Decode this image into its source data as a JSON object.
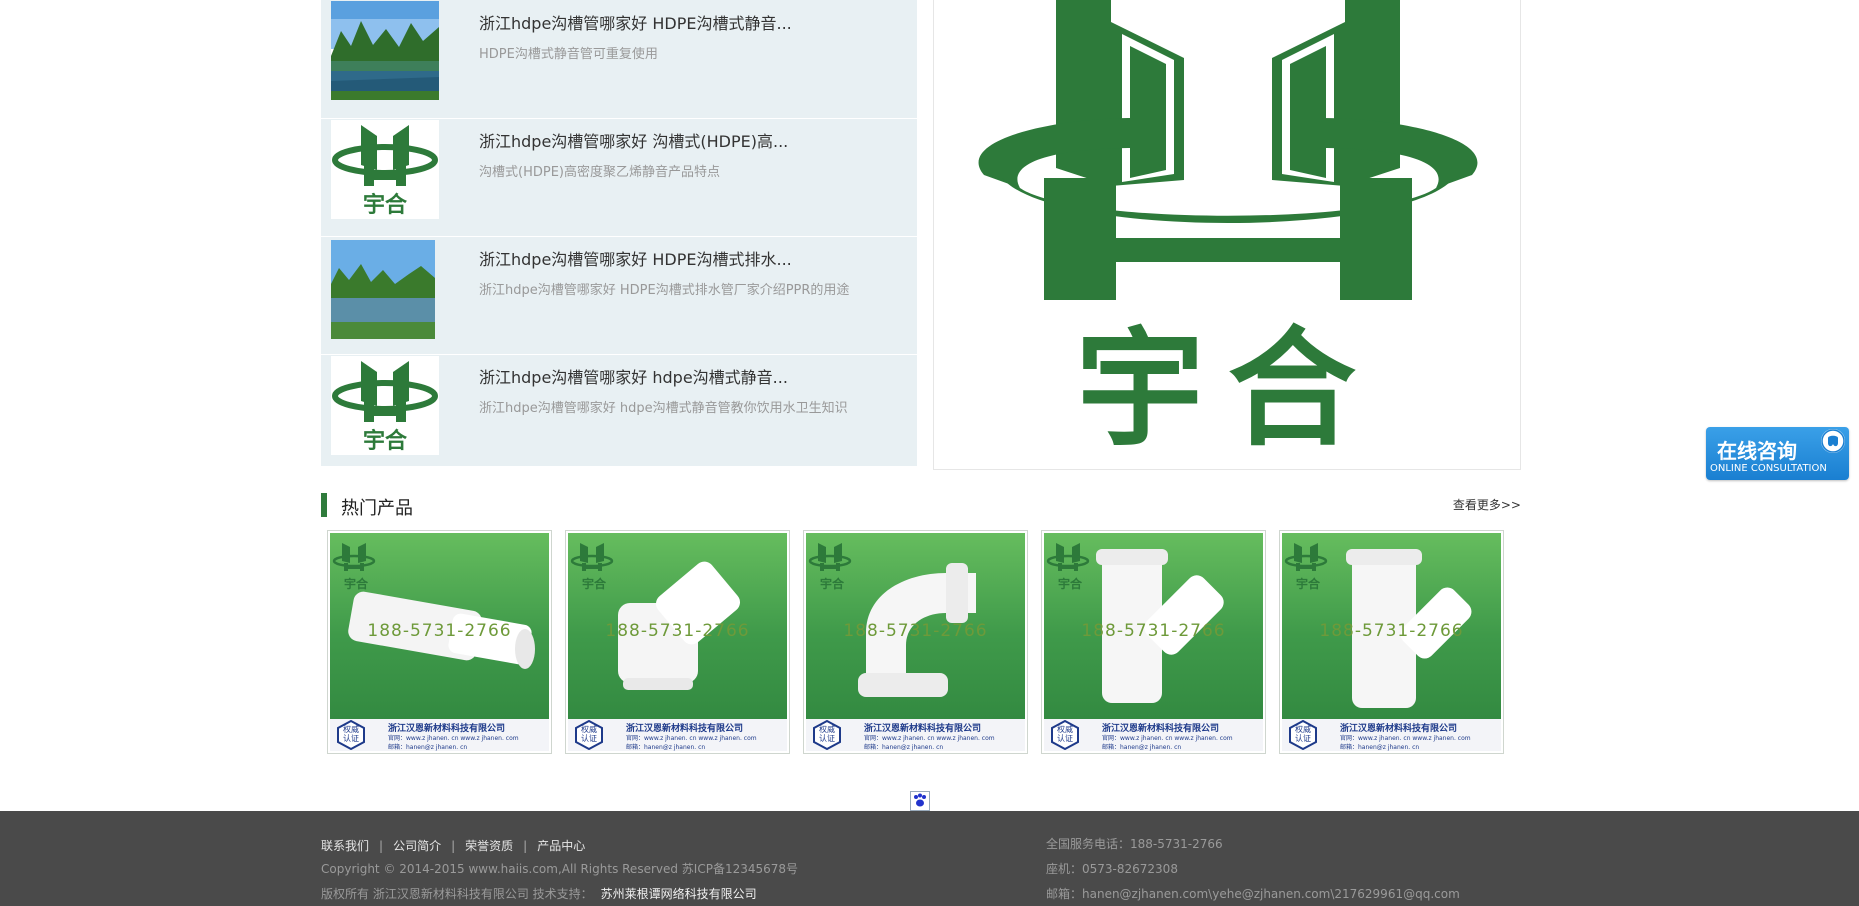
{
  "news": {
    "items": [
      {
        "title": "浙江hdpe沟槽管哪家好 HDPE沟槽式静音...",
        "desc": "HDPE沟槽式静音管可重复使用",
        "thumb": "landscape-photo"
      },
      {
        "title": "浙江hdpe沟槽管哪家好 沟槽式(HDPE)高...",
        "desc": "沟槽式(HDPE)高密度聚乙烯静音产品特点",
        "thumb": "yuhe-logo"
      },
      {
        "title": "浙江hdpe沟槽管哪家好 HDPE沟槽式排水...",
        "desc": "浙江hdpe沟槽管哪家好 HDPE沟槽式排水管厂家介绍PPR的用途",
        "thumb": "landscape-photo"
      },
      {
        "title": "浙江hdpe沟槽管哪家好 hdpe沟槽式静音...",
        "desc": "浙江hdpe沟槽管哪家好 hdpe沟槽式静音管教你饮用水卫生知识",
        "thumb": "yuhe-logo"
      }
    ]
  },
  "logo": {
    "text": "宇合",
    "color": "#2d7a3a"
  },
  "hot_products": {
    "title": "热门产品",
    "more": "查看更多>>",
    "cards": [
      {
        "logo_text": "宇合",
        "phone": "188-5731-2766",
        "company": "浙江汉恩新材料科技有限公司",
        "cert": "权威认证",
        "site_label": "官网：",
        "site1": "www.z jhanen. cn",
        "site2": "www.z jhanen. com",
        "mail_label": "邮箱：",
        "mail": "hanen@z jhanen. cn",
        "shape": "straight-pipe"
      },
      {
        "logo_text": "宇合",
        "phone": "188-5731-2766",
        "company": "浙江汉恩新材料科技有限公司",
        "cert": "权威认证",
        "site_label": "官网：",
        "site1": "www.z jhanen. cn",
        "site2": "www.z jhanen. com",
        "mail_label": "邮箱：",
        "mail": "hanen@z jhanen. cn",
        "shape": "45-elbow-short"
      },
      {
        "logo_text": "宇合",
        "phone": "188-5731-2766",
        "company": "浙江汉恩新材料科技有限公司",
        "cert": "权威认证",
        "site_label": "官网：",
        "site1": "www.z jhanen. cn",
        "site2": "www.z jhanen. com",
        "mail_label": "邮箱：",
        "mail": "hanen@z jhanen. cn",
        "shape": "45-elbow"
      },
      {
        "logo_text": "宇合",
        "phone": "188-5731-2766",
        "company": "浙江汉恩新材料科技有限公司",
        "cert": "权威认证",
        "site_label": "官网：",
        "site1": "www.z jhanen. cn",
        "site2": "www.z jhanen. com",
        "mail_label": "邮箱：",
        "mail": "hanen@z jhanen. cn",
        "shape": "y-tee"
      },
      {
        "logo_text": "宇合",
        "phone": "188-5731-2766",
        "company": "浙江汉恩新材料科技有限公司",
        "cert": "权威认证",
        "site_label": "官网：",
        "site1": "www.z jhanen. cn",
        "site2": "www.z jhanen. com",
        "mail_label": "邮箱：",
        "mail": "hanen@z jhanen. cn",
        "shape": "y-tee-long"
      }
    ]
  },
  "footer": {
    "nav": [
      "联系我们",
      "公司简介",
      "荣誉资质",
      "产品中心"
    ],
    "copyright": "Copyright © 2014-2015 www.haiis.com,All Rights Reserved 苏ICP备12345678号",
    "rights_prefix": "版权所有 浙江汉恩新材料科技有限公司 技术支持：",
    "support": "苏州莱根谭网络科技有限公司",
    "hotline": "全国服务电话：188-5731-2766",
    "phone": "座机：0573-82672308",
    "email": "邮箱：hanen@zjhanen.com\\yehe@zjhanen.com\\217629961@qq.com"
  },
  "consult": {
    "cn": "在线咨询",
    "en": "ONLINE CONSULTATION"
  },
  "colors": {
    "brand_green": "#2d7a3a",
    "footer_bg": "#4a4a4a",
    "consult_blue": "#1a7fd1"
  }
}
